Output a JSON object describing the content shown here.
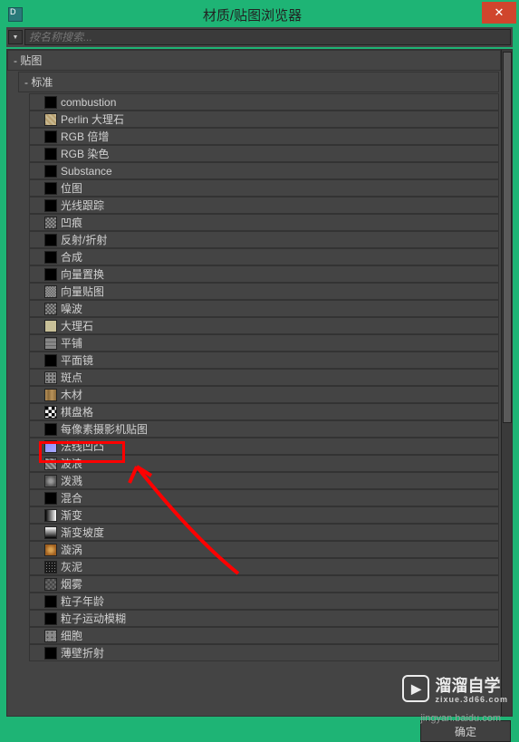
{
  "window": {
    "title": "材质/贴图浏览器"
  },
  "search": {
    "placeholder": "按名称搜索..."
  },
  "groups": {
    "maps": "- 贴图",
    "standard": "- 标准"
  },
  "items": [
    {
      "label": "combustion",
      "icon": "icon-black"
    },
    {
      "label": "Perlin 大理石",
      "icon": "icon-marble"
    },
    {
      "label": "RGB 倍增",
      "icon": "icon-black"
    },
    {
      "label": "RGB 染色",
      "icon": "icon-black"
    },
    {
      "label": "Substance",
      "icon": "icon-black"
    },
    {
      "label": "位图",
      "icon": "icon-black"
    },
    {
      "label": "光线跟踪",
      "icon": "icon-black"
    },
    {
      "label": "凹痕",
      "icon": "icon-noise"
    },
    {
      "label": "反射/折射",
      "icon": "icon-black"
    },
    {
      "label": "合成",
      "icon": "icon-black"
    },
    {
      "label": "向量置换",
      "icon": "icon-black"
    },
    {
      "label": "向量贴图",
      "icon": "icon-noise2"
    },
    {
      "label": "噪波",
      "icon": "icon-noise"
    },
    {
      "label": "大理石",
      "icon": "icon-marble2"
    },
    {
      "label": "平铺",
      "icon": "icon-tile"
    },
    {
      "label": "平面镜",
      "icon": "icon-black"
    },
    {
      "label": "斑点",
      "icon": "icon-dots"
    },
    {
      "label": "木材",
      "icon": "icon-wood"
    },
    {
      "label": "棋盘格",
      "icon": "icon-checker"
    },
    {
      "label": "每像素摄影机贴图",
      "icon": "icon-black"
    },
    {
      "label": "法线凹凸",
      "icon": "icon-normal"
    },
    {
      "label": "波浪",
      "icon": "icon-wave"
    },
    {
      "label": "泼溅",
      "icon": "icon-splash"
    },
    {
      "label": "混合",
      "icon": "icon-black"
    },
    {
      "label": "渐变",
      "icon": "icon-grad"
    },
    {
      "label": "渐变坡度",
      "icon": "icon-gradramp"
    },
    {
      "label": "漩涡",
      "icon": "icon-swirl"
    },
    {
      "label": "灰泥",
      "icon": "icon-dust"
    },
    {
      "label": "烟雾",
      "icon": "icon-smoke"
    },
    {
      "label": "粒子年龄",
      "icon": "icon-black"
    },
    {
      "label": "粒子运动模糊",
      "icon": "icon-black"
    },
    {
      "label": "细胞",
      "icon": "icon-cells"
    },
    {
      "label": "薄壁折射",
      "icon": "icon-black"
    }
  ],
  "footer": {
    "ok": "确定"
  },
  "watermark": {
    "logo_main": "溜溜自学",
    "logo_sub": "zixue.3d66.com",
    "text": "jingyan.baidu.com"
  }
}
